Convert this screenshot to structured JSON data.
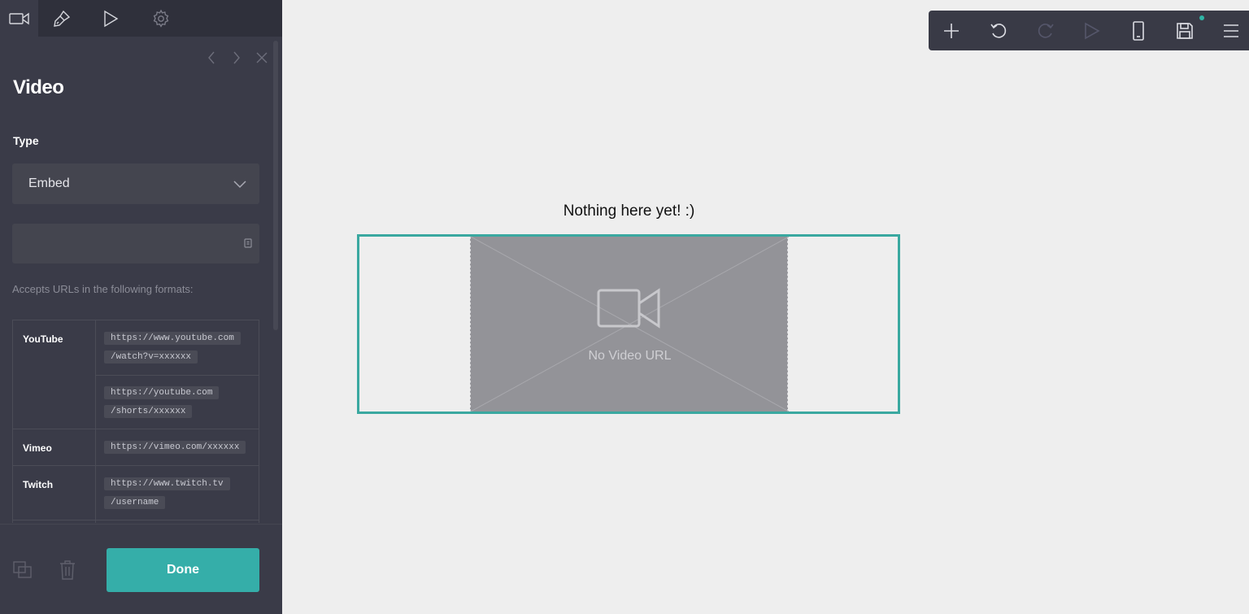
{
  "sidebar": {
    "tabs": [
      {
        "icon": "video-camera-icon",
        "active": true
      },
      {
        "icon": "paint-brush-icon",
        "active": false
      },
      {
        "icon": "play-icon",
        "active": false
      },
      {
        "icon": "gear-icon",
        "active": false
      }
    ],
    "panel": {
      "title": "Video",
      "type_label": "Type",
      "type_value": "Embed",
      "url_value": "",
      "help_text": "Accepts URLs in the following formats:",
      "formats": [
        {
          "name": "YouTube",
          "patterns": [
            [
              "https://www.youtube.com",
              "/watch?v=xxxxxx"
            ],
            [
              "https://youtube.com",
              "/shorts/xxxxxx"
            ]
          ]
        },
        {
          "name": "Vimeo",
          "patterns": [
            [
              "https://vimeo.com/xxxxxx"
            ]
          ]
        },
        {
          "name": "Twitch",
          "patterns": [
            [
              "https://www.twitch.tv",
              "/username"
            ]
          ]
        }
      ]
    },
    "footer": {
      "done_label": "Done"
    }
  },
  "toolbar": {
    "buttons": [
      "add-icon",
      "undo-icon",
      "redo-icon",
      "preview-icon",
      "mobile-view-icon",
      "save-icon",
      "menu-icon"
    ],
    "unsaved_indicator_color": "#2fb5a6"
  },
  "canvas": {
    "empty_message": "Nothing here yet! :)",
    "video_placeholder": "No Video URL",
    "accent_color": "#3aa8a0"
  }
}
